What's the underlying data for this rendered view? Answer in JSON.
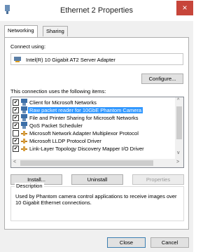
{
  "window": {
    "title": "Ethernet 2 Properties",
    "close_glyph": "×"
  },
  "tabs": [
    {
      "label": "Networking"
    },
    {
      "label": "Sharing"
    }
  ],
  "connect_using": {
    "label": "Connect using:",
    "adapter": "Intel(R) 10 Gigabit AT2 Server Adapter"
  },
  "buttons": {
    "configure": "Configure...",
    "install": "Install...",
    "uninstall": "Uninstall",
    "properties": "Properties",
    "close": "Close",
    "cancel": "Cancel"
  },
  "items_label": "This connection uses the following items:",
  "items": [
    {
      "label": "Client for Microsoft Networks",
      "checked": true,
      "icon": "network-client-icon"
    },
    {
      "label": "Raw packet reader for 10GbE Phantom Camera",
      "checked": true,
      "icon": "network-client-icon"
    },
    {
      "label": "File and Printer Sharing for Microsoft Networks",
      "checked": true,
      "icon": "network-client-icon"
    },
    {
      "label": "QoS Packet Scheduler",
      "checked": true,
      "icon": "network-client-icon"
    },
    {
      "label": "Microsoft Network Adapter Multiplexor Protocol",
      "checked": false,
      "icon": "protocol-icon"
    },
    {
      "label": "Microsoft LLDP Protocol Driver",
      "checked": true,
      "icon": "protocol-icon"
    },
    {
      "label": "Link-Layer Topology Discovery Mapper I/O Driver",
      "checked": true,
      "icon": "protocol-icon"
    }
  ],
  "description": {
    "legend": "Description",
    "text": "Used by Phantom camera control applications to receive images over 10 Gigabit Ethernet connections."
  }
}
